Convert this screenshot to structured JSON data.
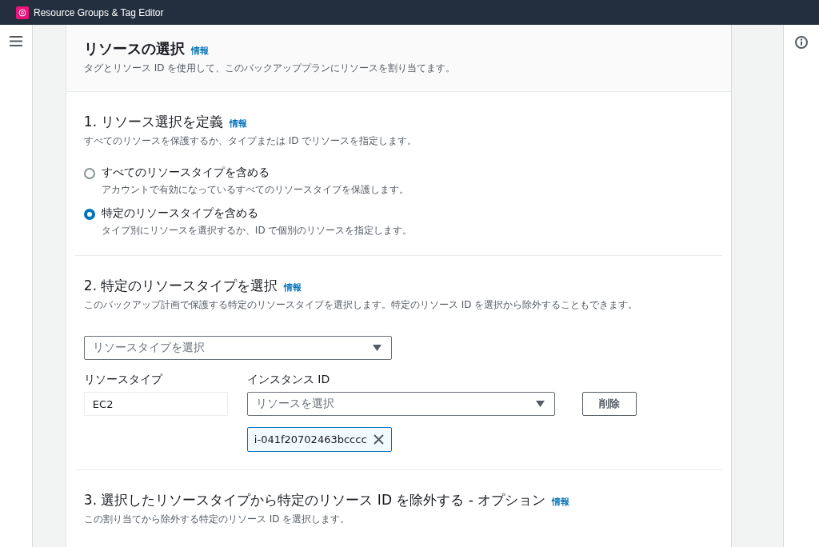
{
  "top_bar": {
    "title": "Resource Groups & Tag Editor"
  },
  "header": {
    "title": "リソースの選択",
    "info_link": "情報",
    "description": "タグとリソース ID を使用して、このバックアッププランにリソースを割り当てます。"
  },
  "section_1": {
    "title": "1. リソース選択を定義",
    "info_link": "情報",
    "description": "すべてのリソースを保護するか、タイプまたは ID でリソースを指定します。",
    "options": [
      {
        "label": "すべてのリソースタイプを含める",
        "description": "アカウントで有効になっているすべてのリソースタイプを保護します。",
        "selected": false
      },
      {
        "label": "特定のリソースタイプを含める",
        "description": "タイプ別にリソースを選択するか、ID で個別のリソースを指定します。",
        "selected": true
      }
    ]
  },
  "section_2": {
    "title": "2. 特定のリソースタイプを選択",
    "info_link": "情報",
    "description": "このバックアップ計画で保護する特定のリソースタイプを選択します。特定のリソース ID を選択から除外することもできます。",
    "resource_type_select": {
      "placeholder": "リソースタイプを選択"
    },
    "resource_type_label": "リソースタイプ",
    "instance_id_label": "インスタンス ID",
    "rows": [
      {
        "resource_type": "EC2",
        "instance_select": {
          "placeholder": "リソースを選択"
        },
        "remove_button": "削除",
        "tokens": [
          "i-041f20702463bcccc"
        ]
      }
    ]
  },
  "section_3": {
    "title": "3. 選択したリソースタイプから特定のリソース ID を除外する - オプション",
    "info_link": "情報",
    "description": "この割り当てから除外する特定のリソース ID を選択します。"
  }
}
